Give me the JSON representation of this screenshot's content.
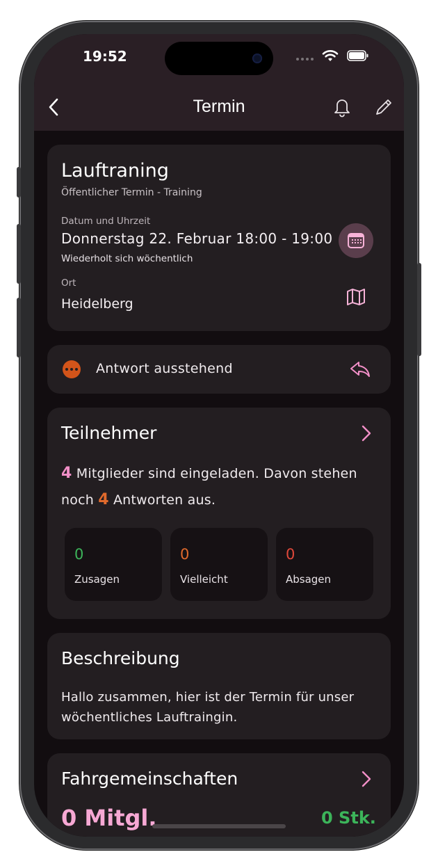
{
  "status_bar": {
    "time": "19:52"
  },
  "header": {
    "title": "Termin"
  },
  "event": {
    "title": "Lauftraning",
    "subtitle": "Öffentlicher Termin - Training",
    "date_label": "Datum und Uhrzeit",
    "date_value": "Donnerstag 22. Februar 18:00 - 19:00",
    "repeat": "Wiederholt sich wöchentlich",
    "place_label": "Ort",
    "place_value": "Heidelberg"
  },
  "response": {
    "text": "Antwort ausstehend"
  },
  "participants": {
    "title": "Teilnehmer",
    "invited_count": "4",
    "text_part1": " Mitglieder sind eingeladen. Davon stehen noch ",
    "pending_count": "4",
    "text_part2": " Antworten aus.",
    "stats": [
      {
        "value": "0",
        "label": "Zusagen",
        "color": "#3cb45a"
      },
      {
        "value": "0",
        "label": "Vielleicht",
        "color": "#e06a2c"
      },
      {
        "value": "0",
        "label": "Absagen",
        "color": "#e0483a"
      }
    ]
  },
  "description": {
    "title": "Beschreibung",
    "text": "Hallo zusammen, hier ist der Termin für unser wöchentliches Lauftraingin."
  },
  "carpool": {
    "title": "Fahrgemeinschaften",
    "members": "0 Mitgl.",
    "count": "0 Stk."
  },
  "colors": {
    "accent": "#f28fc7",
    "pending": "#d2541a",
    "background": "#120d10",
    "card": "#231e21"
  }
}
